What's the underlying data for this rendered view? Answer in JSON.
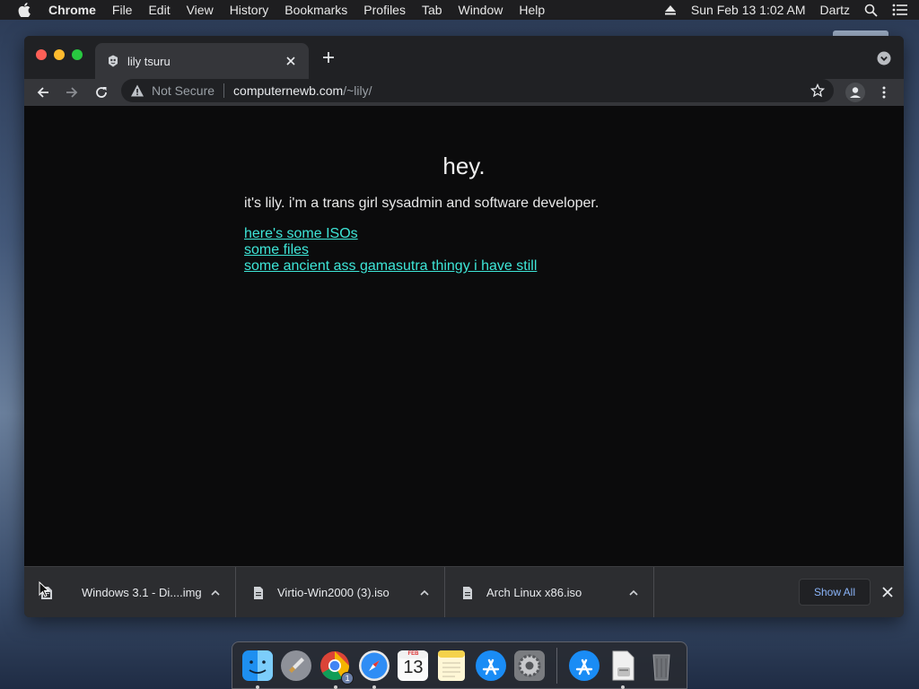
{
  "menubar": {
    "app_name": "Chrome",
    "menus": [
      "File",
      "Edit",
      "View",
      "History",
      "Bookmarks",
      "Profiles",
      "Tab",
      "Window",
      "Help"
    ],
    "datetime": "Sun Feb 13  1:02 AM",
    "user": "Dartz"
  },
  "tab": {
    "title": "lily tsuru"
  },
  "omnibox": {
    "security_label": "Not Secure",
    "host": "computernewb.com",
    "path": "/~lily/"
  },
  "page": {
    "heading": "hey.",
    "intro": "it's lily. i'm a trans girl sysadmin and software developer.",
    "links": [
      "here's some ISOs",
      "some files",
      "some ancient ass gamasutra thingy i have still"
    ],
    "link_color": "#3ee6d8"
  },
  "downloads": {
    "items": [
      "Windows 3.1 - Di....img",
      "Virtio-Win2000 (3).iso",
      "Arch Linux x86.iso"
    ],
    "show_all_label": "Show All"
  },
  "dock": {
    "calendar_month": "FEB",
    "calendar_day": "13",
    "chrome_badge": "1"
  }
}
